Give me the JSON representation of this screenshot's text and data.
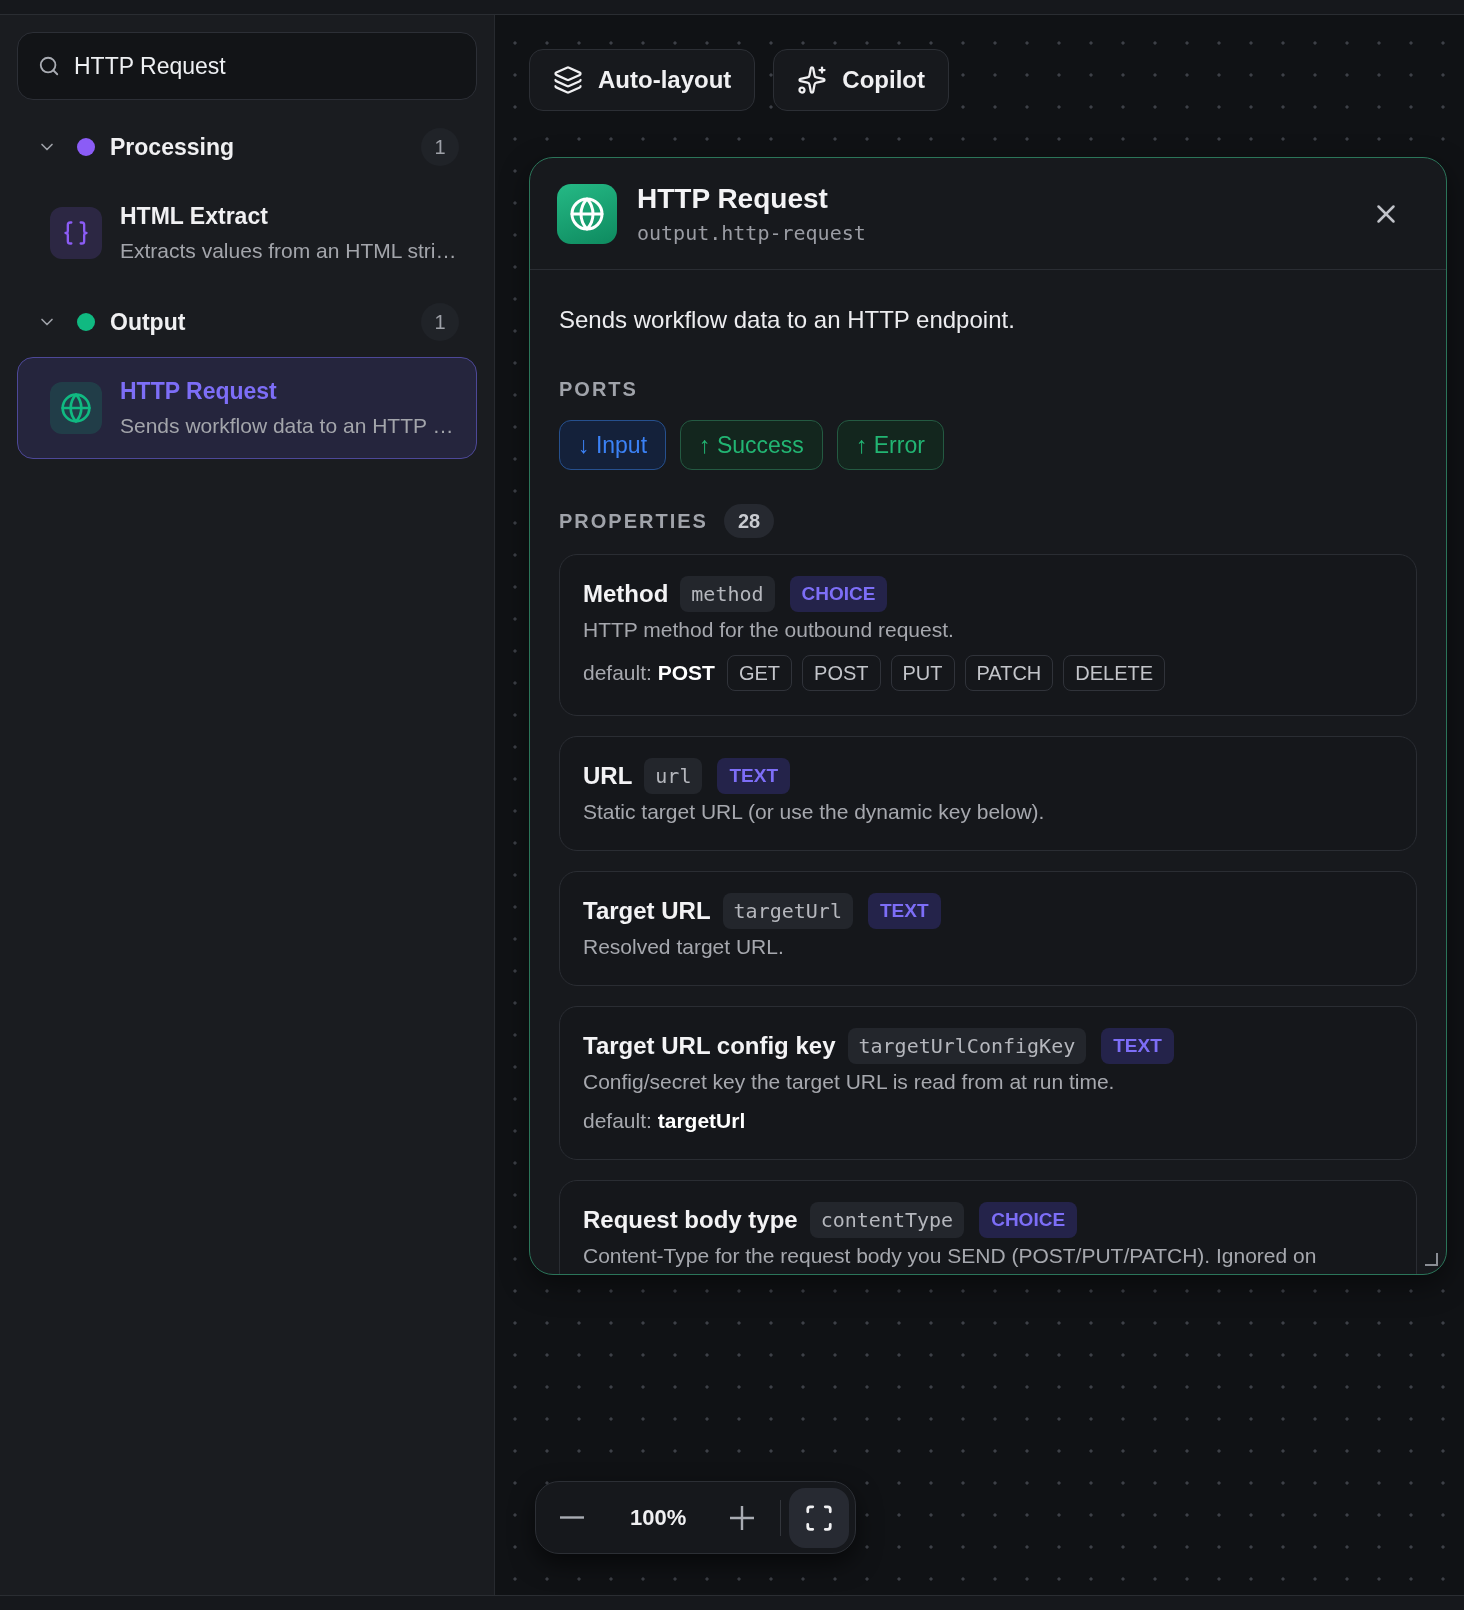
{
  "search": {
    "value": "HTTP Request"
  },
  "groups": [
    {
      "name": "Processing",
      "color": "#8b5cf6",
      "count": "1",
      "expanded": true,
      "items": [
        {
          "kind": "code",
          "title": "HTML Extract",
          "subtitle": "Extracts values from an HTML stri…",
          "selected": false
        }
      ]
    },
    {
      "name": "Output",
      "color": "#10b981",
      "count": "1",
      "expanded": true,
      "items": [
        {
          "kind": "web",
          "title": "HTTP Request",
          "subtitle": "Sends workflow data to an HTTP …",
          "selected": true
        }
      ]
    }
  ],
  "toolbar": [
    {
      "kind": "layout",
      "label": "Auto-layout"
    },
    {
      "kind": "copilot",
      "label": "Copilot"
    }
  ],
  "panel": {
    "kind": "web",
    "title": "HTTP Request",
    "subtitle": "output.http-request",
    "description": "Sends workflow data to an HTTP endpoint.",
    "ports_heading": "PORTS",
    "ports": [
      {
        "kind": "input",
        "label": "↓ Input"
      },
      {
        "kind": "output",
        "label": "↑ Success"
      },
      {
        "kind": "output",
        "label": "↑ Error"
      }
    ],
    "properties_heading": "PROPERTIES",
    "properties_count": "28",
    "properties": [
      {
        "name": "Method",
        "key": "method",
        "type": "CHOICE",
        "description": "HTTP method for the outbound request.",
        "default": "default: **POST**",
        "options": [
          "GET",
          "POST",
          "PUT",
          "PATCH",
          "DELETE"
        ]
      },
      {
        "name": "URL",
        "key": "url",
        "type": "TEXT",
        "description": "Static target URL (or use the dynamic key below)."
      },
      {
        "name": "Target URL",
        "key": "targetUrl",
        "type": "TEXT",
        "description": "Resolved target URL."
      },
      {
        "name": "Target URL config key",
        "key": "targetUrlConfigKey",
        "type": "TEXT",
        "description": "Config/secret key the target URL is read from at run time.",
        "default": "default: **targetUrl**"
      },
      {
        "name": "Request body type",
        "key": "contentType",
        "type": "CHOICE",
        "description": "Content-Type for the request body you SEND (POST/PUT/PATCH). Ignored on"
      }
    ]
  },
  "zoom": {
    "value": "100%"
  }
}
